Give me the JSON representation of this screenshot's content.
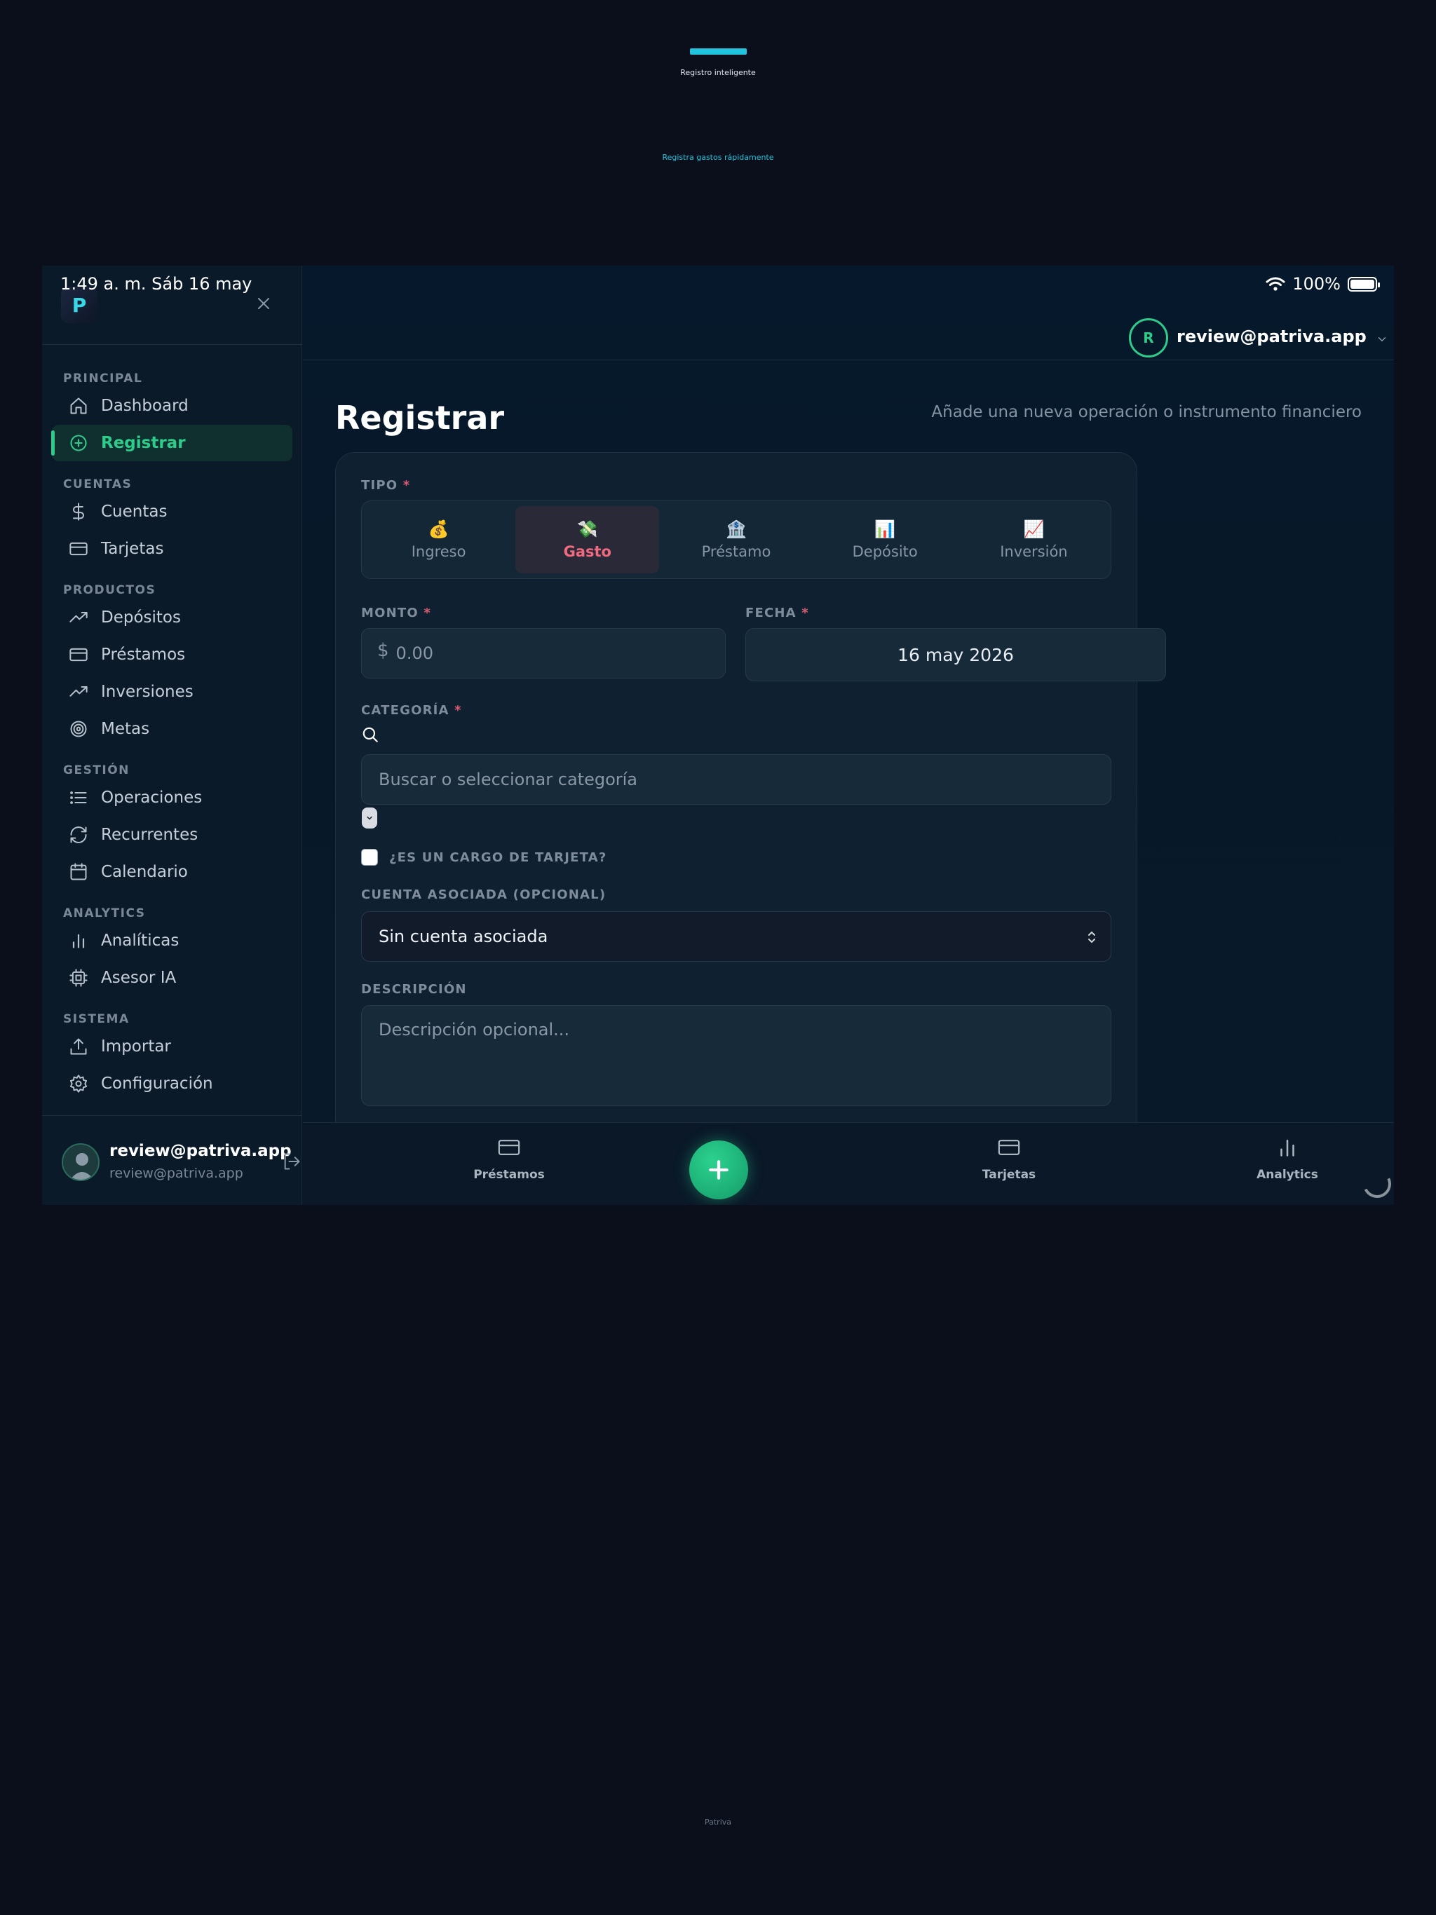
{
  "promo": {
    "title": "Registro inteligente",
    "subtitle": "Registra gastos rápidamente",
    "footer": "Patriva"
  },
  "status_bar": {
    "time": "1:49 a. m.   Sáb 16 may",
    "battery": "100%"
  },
  "sidebar": {
    "logo_letter": "P",
    "sections": {
      "principal": "PRINCIPAL",
      "cuentas": "CUENTAS",
      "productos": "PRODUCTOS",
      "gestion": "GESTIÓN",
      "analytics": "ANALYTICS",
      "sistema": "SISTEMA"
    },
    "items": {
      "dashboard": "Dashboard",
      "registrar": "Registrar",
      "cuentas": "Cuentas",
      "tarjetas": "Tarjetas",
      "depositos": "Depósitos",
      "prestamos": "Préstamos",
      "inversiones": "Inversiones",
      "metas": "Metas",
      "operaciones": "Operaciones",
      "recurrentes": "Recurrentes",
      "calendario": "Calendario",
      "analiticas": "Analíticas",
      "asesor": "Asesor IA",
      "importar": "Importar",
      "configuracion": "Configuración"
    },
    "active_item": "registrar",
    "user": {
      "name": "review@patriva.app",
      "email": "review@patriva.app"
    }
  },
  "topbar": {
    "avatar_initial": "R",
    "account_email": "review@patriva.app"
  },
  "page": {
    "title": "Registrar",
    "subtitle": "Añade una nueva operación o instrumento financiero"
  },
  "form": {
    "tipo_label": "TIPO",
    "required_mark": "*",
    "types": [
      {
        "emoji": "💰",
        "label": "Ingreso"
      },
      {
        "emoji": "💸",
        "label": "Gasto"
      },
      {
        "emoji": "🏦",
        "label": "Préstamo"
      },
      {
        "emoji": "📊",
        "label": "Depósito"
      },
      {
        "emoji": "📈",
        "label": "Inversión"
      }
    ],
    "selected_type": "Gasto",
    "monto_label": "MONTO",
    "currency_symbol": "$",
    "monto_placeholder": "0.00",
    "fecha_label": "FECHA",
    "fecha_value": "16 may 2026",
    "categoria_label": "CATEGORÍA",
    "categoria_placeholder": "Buscar o seleccionar categoría",
    "tarjeta_checkbox_label": "¿ES UN CARGO DE TARJETA?",
    "cuenta_label": "CUENTA ASOCIADA (OPCIONAL)",
    "cuenta_value": "Sin cuenta asociada",
    "descripcion_label": "DESCRIPCIÓN",
    "descripcion_placeholder": "Descripción opcional..."
  },
  "bottom_nav": {
    "prestamos": "Préstamos",
    "tarjetas": "Tarjetas",
    "analytics": "Analytics"
  },
  "colors": {
    "accent": "#2ecc8a",
    "danger": "#f06a80",
    "promo": "#22c3dc",
    "background": "#0a0f1b"
  }
}
